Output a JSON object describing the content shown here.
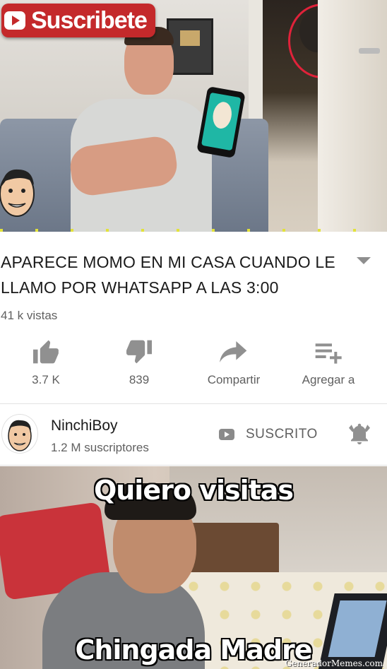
{
  "video": {
    "overlay_subscribe_text": "Suscribete"
  },
  "video_info": {
    "title": "APARECE MOMO EN MI CASA CUANDO LE LLAMO POR WHATSAPP A LAS 3:00",
    "views": "41 k vistas",
    "expand_icon": "chevron-down-icon"
  },
  "actions": [
    {
      "icon": "thumbs-up-icon",
      "label": "3.7 K"
    },
    {
      "icon": "thumbs-down-icon",
      "label": "839"
    },
    {
      "icon": "share-icon",
      "label": "Compartir"
    },
    {
      "icon": "add-to-playlist-icon",
      "label": "Agregar a"
    }
  ],
  "channel": {
    "name": "NinchiBoy",
    "subscribers": "1.2 M suscriptores",
    "subscribed_label": "SUSCRITO",
    "bell_icon": "notification-bell-icon"
  },
  "meme": {
    "top_text": "Quiero visitas",
    "bottom_text": "Chingada Madre",
    "watermark": "GeneradorMemes.com"
  },
  "colors": {
    "icon_gray": "#909090",
    "text_dark": "#1a1a1a",
    "text_gray": "#606060",
    "subscribe_red": "#c4292b",
    "highlight_circle": "#e0223a"
  }
}
